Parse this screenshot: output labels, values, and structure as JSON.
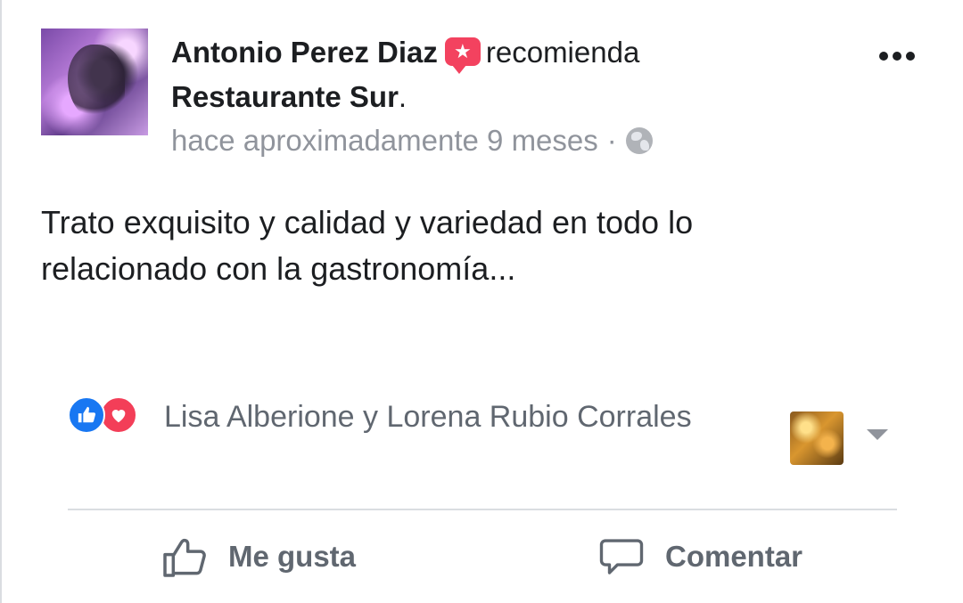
{
  "post": {
    "author": "Antonio Perez Diaz",
    "verb": "recomienda",
    "page": "Restaurante Sur",
    "page_suffix": ".",
    "recommend_icon_glyph": "★",
    "timestamp": "hace aproximadamente 9 meses",
    "separator": "·",
    "privacy_icon": "globe-icon",
    "text_line1": "Trato exquisito y calidad y variedad en todo lo",
    "text_line2": "relacionado con la gastronomía..."
  },
  "reactions": {
    "like_glyph": "👍",
    "love_glyph": "♥",
    "names": "Lisa Alberione y Lorena Rubio Corrales"
  },
  "actions": {
    "like_label": "Me gusta",
    "comment_label": "Comentar"
  },
  "colors": {
    "like_blue": "#1877f2",
    "love_red": "#f33e58",
    "recommend_red": "#f3425f",
    "secondary_text": "#606770",
    "meta_text": "#90949c"
  }
}
